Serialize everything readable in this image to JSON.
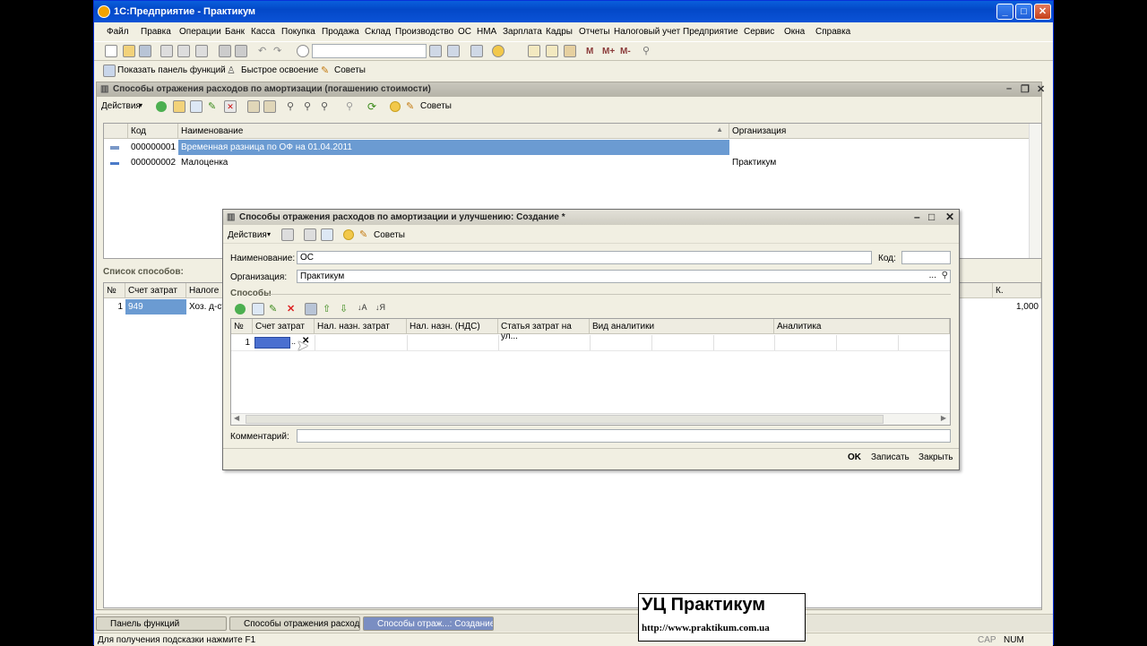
{
  "app": {
    "title": "1С:Предприятие - Практикум",
    "menu": [
      "Файл",
      "Правка",
      "Операции",
      "Банк",
      "Касса",
      "Покупка",
      "Продажа",
      "Склад",
      "Производство",
      "ОС",
      "НМА",
      "Зарплата",
      "Кадры",
      "Отчеты",
      "Налоговый учет",
      "Предприятие",
      "Сервис",
      "Окна",
      "Справка"
    ],
    "toolbar2": {
      "panel": "Показать панель функций",
      "quick": "Быстрое освоение",
      "tips": "Советы"
    },
    "toolbar1": {
      "m1": "M",
      "m2": "M+",
      "m3": "M-"
    }
  },
  "list_window": {
    "title": "Способы отражения расходов по амортизации (погашению стоимости)",
    "actions": "Действия",
    "tips": "Советы",
    "columns": {
      "code": "Код",
      "name": "Наименование",
      "org": "Организация"
    },
    "rows": [
      {
        "code": "000000001",
        "name": "Временная разница по ОФ на 01.04.2011",
        "org": ""
      },
      {
        "code": "000000002",
        "name": "Малоценка",
        "org": "Практикум"
      }
    ],
    "list_label": "Список способов:",
    "sub_columns": {
      "n": "№",
      "account": "Счет затрат",
      "tax": "Налоге",
      "k": "К."
    },
    "sub_row": {
      "n": "1",
      "account": "949",
      "tax": "Хоз. д-ст",
      "k": "1,000"
    }
  },
  "dialog": {
    "title": "Способы отражения расходов по амортизации и улучшению: Создание *",
    "actions": "Действия",
    "tips": "Советы",
    "name_label": "Наименование:",
    "name_value": "ОС",
    "code_label": "Код:",
    "code_value": "",
    "org_label": "Организация:",
    "org_value": "Практикум",
    "section": "Способы",
    "columns": {
      "n": "№",
      "account": "Счет затрат",
      "tax_purpose": "Нал. назн. затрат",
      "vat_purpose": "Нал. назн. (НДС)",
      "cost_item": "Статья затрат на ул...",
      "analytics_type": "Вид аналитики",
      "analytics": "Аналитика"
    },
    "row_n": "1",
    "comment_label": "Комментарий:",
    "comment_value": "",
    "ok": "OK",
    "save": "Записать",
    "close": "Закрыть"
  },
  "taskbar": {
    "panel": "Панель функций",
    "list": "Способы отражения расход...",
    "dialog": "Способы отраж...: Создание *"
  },
  "status": {
    "hint": "Для получения подсказки нажмите F1",
    "cap": "CAP",
    "num": "NUM"
  },
  "watermark": {
    "title": "УЦ Практикум",
    "url": "http://www.praktikum.com.ua"
  }
}
